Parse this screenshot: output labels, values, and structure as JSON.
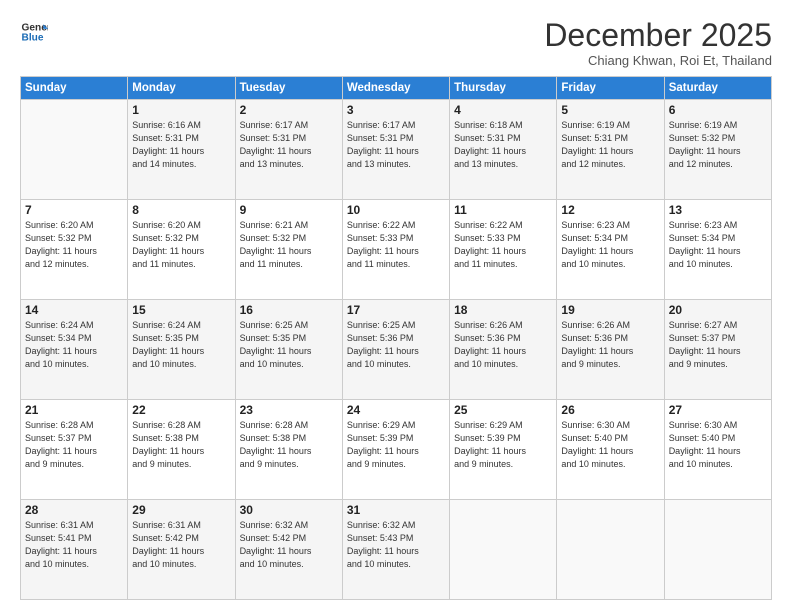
{
  "header": {
    "logo_line1": "General",
    "logo_line2": "Blue",
    "month": "December 2025",
    "location": "Chiang Khwan, Roi Et, Thailand"
  },
  "weekdays": [
    "Sunday",
    "Monday",
    "Tuesday",
    "Wednesday",
    "Thursday",
    "Friday",
    "Saturday"
  ],
  "weeks": [
    [
      {
        "day": "",
        "info": ""
      },
      {
        "day": "1",
        "info": "Sunrise: 6:16 AM\nSunset: 5:31 PM\nDaylight: 11 hours\nand 14 minutes."
      },
      {
        "day": "2",
        "info": "Sunrise: 6:17 AM\nSunset: 5:31 PM\nDaylight: 11 hours\nand 13 minutes."
      },
      {
        "day": "3",
        "info": "Sunrise: 6:17 AM\nSunset: 5:31 PM\nDaylight: 11 hours\nand 13 minutes."
      },
      {
        "day": "4",
        "info": "Sunrise: 6:18 AM\nSunset: 5:31 PM\nDaylight: 11 hours\nand 13 minutes."
      },
      {
        "day": "5",
        "info": "Sunrise: 6:19 AM\nSunset: 5:31 PM\nDaylight: 11 hours\nand 12 minutes."
      },
      {
        "day": "6",
        "info": "Sunrise: 6:19 AM\nSunset: 5:32 PM\nDaylight: 11 hours\nand 12 minutes."
      }
    ],
    [
      {
        "day": "7",
        "info": "Sunrise: 6:20 AM\nSunset: 5:32 PM\nDaylight: 11 hours\nand 12 minutes."
      },
      {
        "day": "8",
        "info": "Sunrise: 6:20 AM\nSunset: 5:32 PM\nDaylight: 11 hours\nand 11 minutes."
      },
      {
        "day": "9",
        "info": "Sunrise: 6:21 AM\nSunset: 5:32 PM\nDaylight: 11 hours\nand 11 minutes."
      },
      {
        "day": "10",
        "info": "Sunrise: 6:22 AM\nSunset: 5:33 PM\nDaylight: 11 hours\nand 11 minutes."
      },
      {
        "day": "11",
        "info": "Sunrise: 6:22 AM\nSunset: 5:33 PM\nDaylight: 11 hours\nand 11 minutes."
      },
      {
        "day": "12",
        "info": "Sunrise: 6:23 AM\nSunset: 5:34 PM\nDaylight: 11 hours\nand 10 minutes."
      },
      {
        "day": "13",
        "info": "Sunrise: 6:23 AM\nSunset: 5:34 PM\nDaylight: 11 hours\nand 10 minutes."
      }
    ],
    [
      {
        "day": "14",
        "info": "Sunrise: 6:24 AM\nSunset: 5:34 PM\nDaylight: 11 hours\nand 10 minutes."
      },
      {
        "day": "15",
        "info": "Sunrise: 6:24 AM\nSunset: 5:35 PM\nDaylight: 11 hours\nand 10 minutes."
      },
      {
        "day": "16",
        "info": "Sunrise: 6:25 AM\nSunset: 5:35 PM\nDaylight: 11 hours\nand 10 minutes."
      },
      {
        "day": "17",
        "info": "Sunrise: 6:25 AM\nSunset: 5:36 PM\nDaylight: 11 hours\nand 10 minutes."
      },
      {
        "day": "18",
        "info": "Sunrise: 6:26 AM\nSunset: 5:36 PM\nDaylight: 11 hours\nand 10 minutes."
      },
      {
        "day": "19",
        "info": "Sunrise: 6:26 AM\nSunset: 5:36 PM\nDaylight: 11 hours\nand 9 minutes."
      },
      {
        "day": "20",
        "info": "Sunrise: 6:27 AM\nSunset: 5:37 PM\nDaylight: 11 hours\nand 9 minutes."
      }
    ],
    [
      {
        "day": "21",
        "info": "Sunrise: 6:28 AM\nSunset: 5:37 PM\nDaylight: 11 hours\nand 9 minutes."
      },
      {
        "day": "22",
        "info": "Sunrise: 6:28 AM\nSunset: 5:38 PM\nDaylight: 11 hours\nand 9 minutes."
      },
      {
        "day": "23",
        "info": "Sunrise: 6:28 AM\nSunset: 5:38 PM\nDaylight: 11 hours\nand 9 minutes."
      },
      {
        "day": "24",
        "info": "Sunrise: 6:29 AM\nSunset: 5:39 PM\nDaylight: 11 hours\nand 9 minutes."
      },
      {
        "day": "25",
        "info": "Sunrise: 6:29 AM\nSunset: 5:39 PM\nDaylight: 11 hours\nand 9 minutes."
      },
      {
        "day": "26",
        "info": "Sunrise: 6:30 AM\nSunset: 5:40 PM\nDaylight: 11 hours\nand 10 minutes."
      },
      {
        "day": "27",
        "info": "Sunrise: 6:30 AM\nSunset: 5:40 PM\nDaylight: 11 hours\nand 10 minutes."
      }
    ],
    [
      {
        "day": "28",
        "info": "Sunrise: 6:31 AM\nSunset: 5:41 PM\nDaylight: 11 hours\nand 10 minutes."
      },
      {
        "day": "29",
        "info": "Sunrise: 6:31 AM\nSunset: 5:42 PM\nDaylight: 11 hours\nand 10 minutes."
      },
      {
        "day": "30",
        "info": "Sunrise: 6:32 AM\nSunset: 5:42 PM\nDaylight: 11 hours\nand 10 minutes."
      },
      {
        "day": "31",
        "info": "Sunrise: 6:32 AM\nSunset: 5:43 PM\nDaylight: 11 hours\nand 10 minutes."
      },
      {
        "day": "",
        "info": ""
      },
      {
        "day": "",
        "info": ""
      },
      {
        "day": "",
        "info": ""
      }
    ]
  ]
}
